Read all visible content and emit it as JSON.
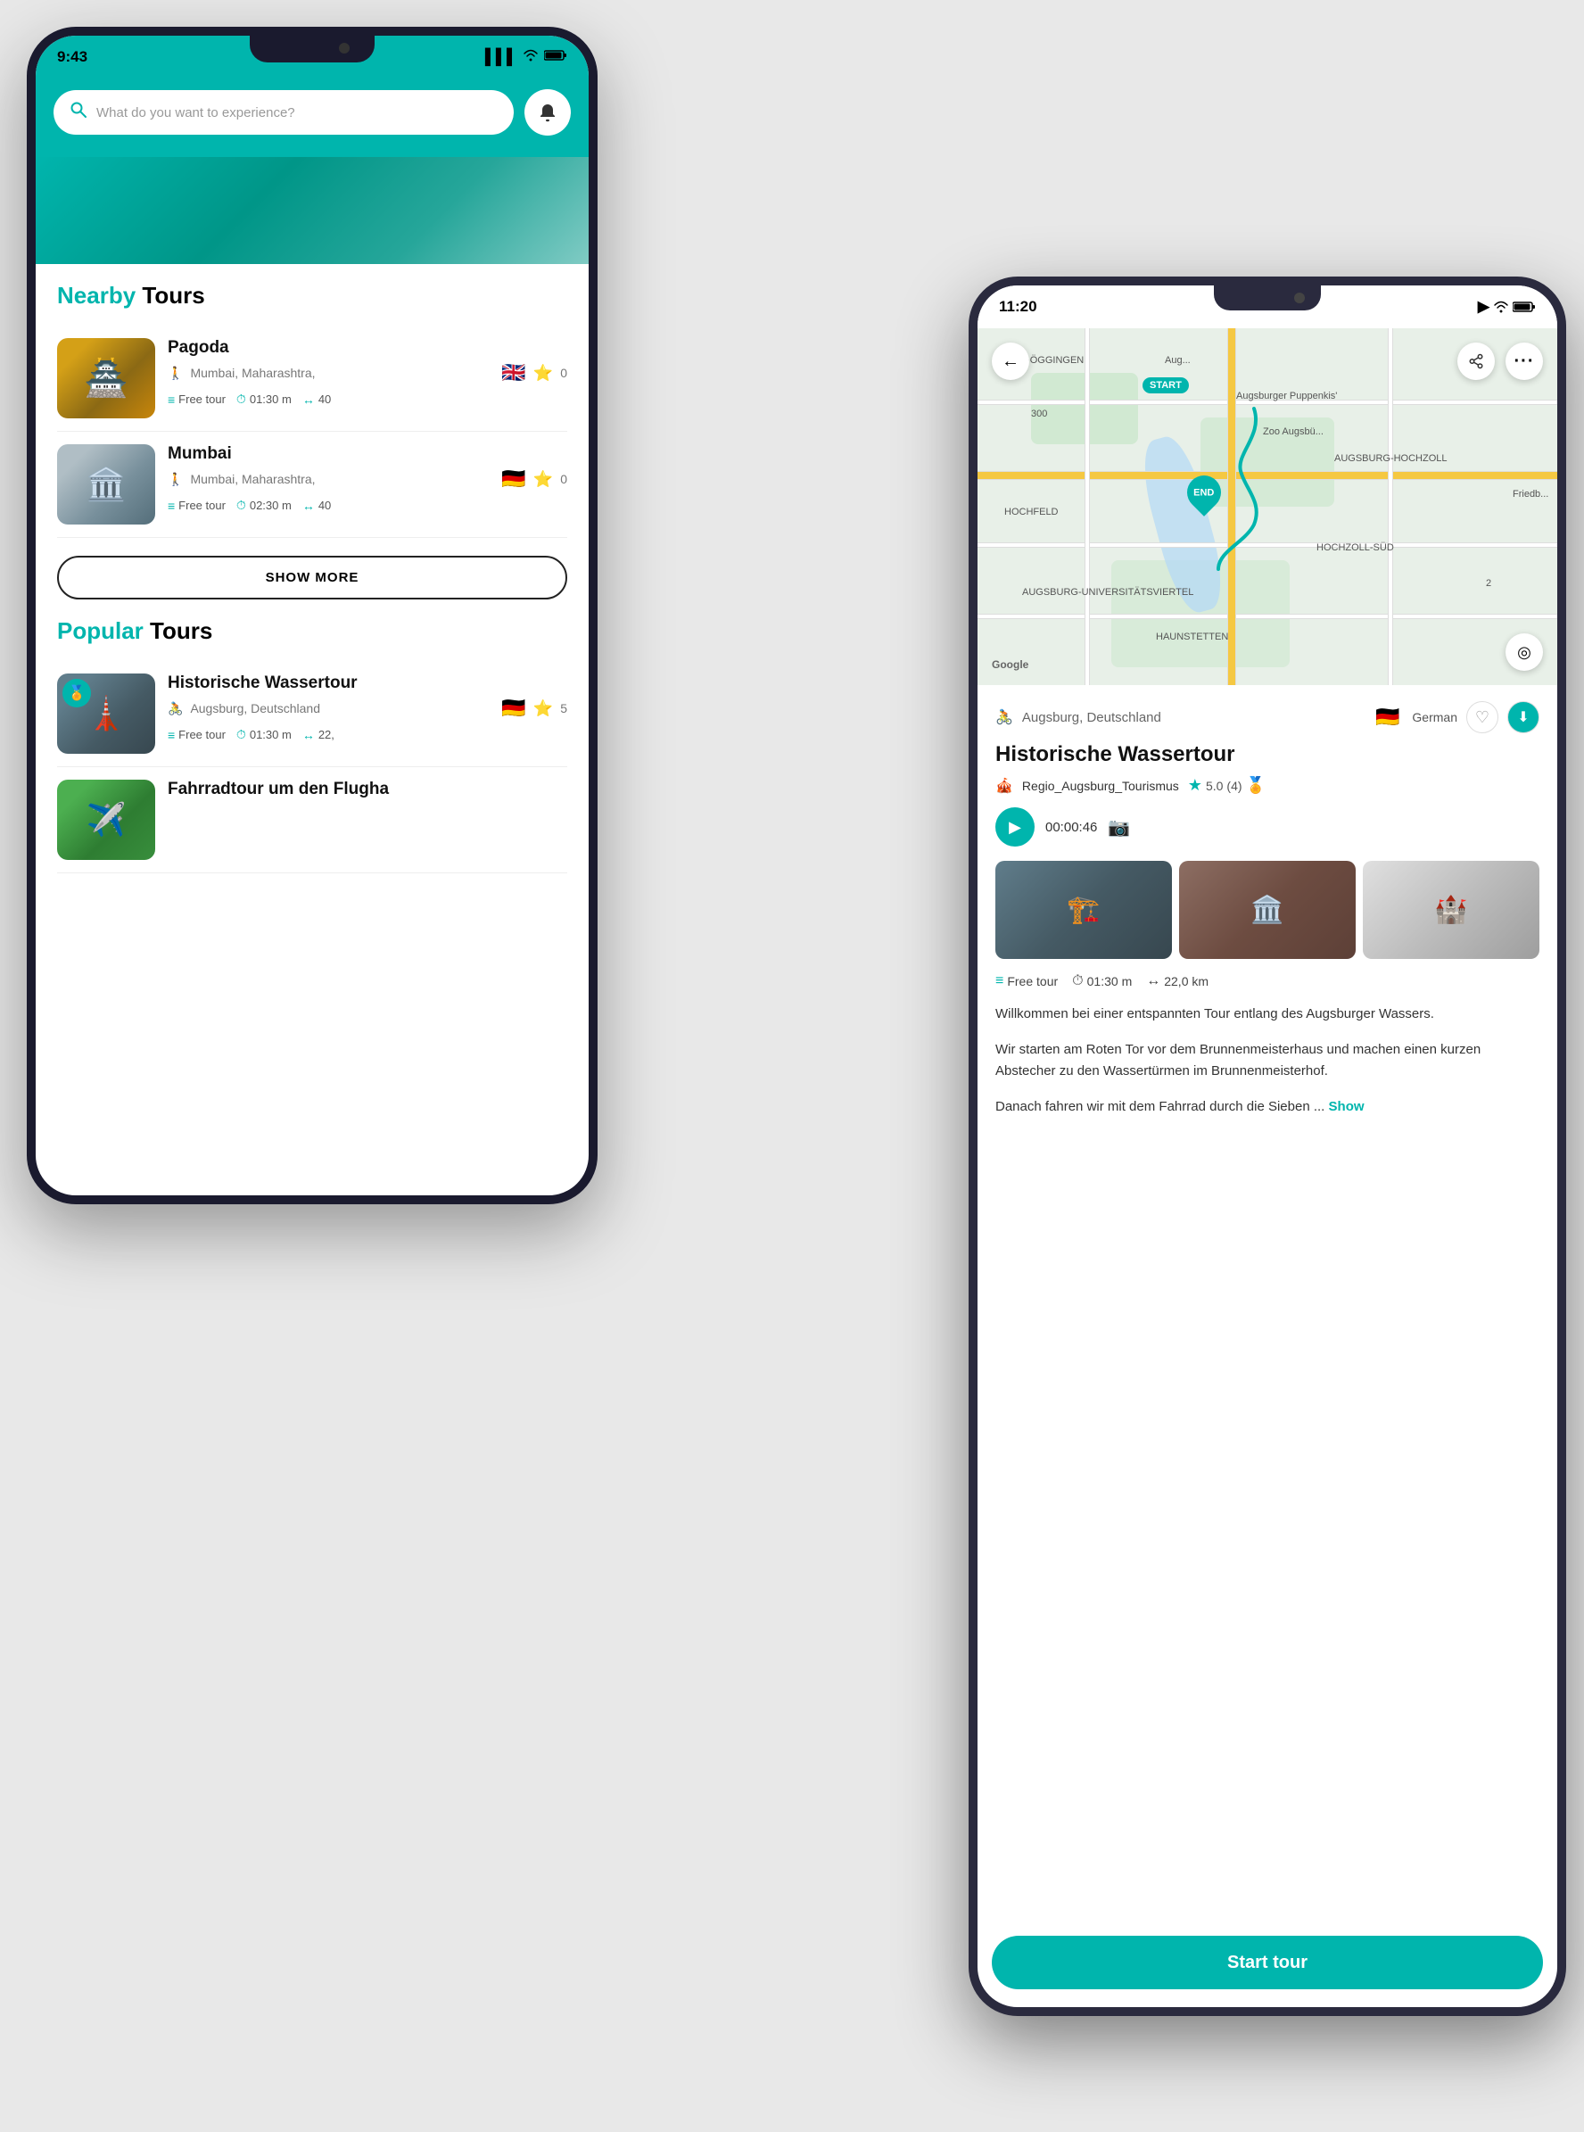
{
  "phone1": {
    "status": {
      "time": "9:43",
      "location_arrow": "▶",
      "signal": "▌▌▌",
      "wifi": "wifi",
      "battery": "battery"
    },
    "header": {
      "search_placeholder": "What do you want to experience?",
      "bell_icon": "🔔"
    },
    "nearby_section": {
      "title_accent": "Nearby",
      "title_rest": " Tours"
    },
    "tour1": {
      "name": "Pagoda",
      "location": "Mumbai, Maharashtra,",
      "flag": "🇬🇧",
      "rating": "0",
      "badge_free": "Free tour",
      "duration": "01:30 m",
      "distance": "40"
    },
    "tour2": {
      "name": "Mumbai",
      "location": "Mumbai, Maharashtra,",
      "flag": "🇩🇪",
      "rating": "0",
      "badge_free": "Free tour",
      "duration": "02:30 m",
      "distance": "40"
    },
    "show_more": "SHOW MORE",
    "popular_section": {
      "title_accent": "Popular",
      "title_rest": " Tours"
    },
    "popular_tour1": {
      "name": "Historische Wassertour",
      "location": "Augsburg, Deutschland",
      "flag": "🇩🇪",
      "rating": "5",
      "badge_free": "Free tour",
      "duration": "01:30 m",
      "distance": "22,"
    },
    "popular_tour2": {
      "name": "Fahrradtour um den Flugha",
      "location": "",
      "flag": "",
      "rating": ""
    }
  },
  "phone2": {
    "status": {
      "time": "11:20",
      "location_arrow": "▶",
      "signal": "wifi"
    },
    "map": {
      "back_icon": "←",
      "share_icon": "⇧",
      "more_icon": "•••",
      "location_icon": "◎",
      "google_label": "Google",
      "start_label": "START",
      "end_label": "END"
    },
    "detail": {
      "bike_icon": "🚴",
      "location": "Augsburg, Deutschland",
      "flag": "🇩🇪",
      "language": "German",
      "heart_icon": "♡",
      "download_icon": "⬇",
      "title": "Historische Wassertour",
      "author_icon": "🎪",
      "author_name": "Regio_Augsburg_Tourismus",
      "star_icon": "⭐",
      "rating": "5.0",
      "reviews": "(4)",
      "award_icon": "🏅",
      "video_time": "00:00:46",
      "camera_icon": "📷",
      "free_badge": "Free tour",
      "duration_icon": "⏱",
      "duration": "01:30 m",
      "distance_icon": "↔",
      "distance": "22,0 km",
      "description1": "Willkommen bei einer entspannten Tour entlang des Augsburger Wassers.",
      "description2": "Wir starten am Roten Tor vor dem Brunnenmeisterhaus und machen einen kurzen Abstecher zu den Wassertürmen im Brunnenmeisterhof.",
      "description3": "Danach fahren wir mit dem Fahrrad durch die Sieben ...",
      "show_link": "Show",
      "start_tour_btn": "Start tour"
    }
  }
}
